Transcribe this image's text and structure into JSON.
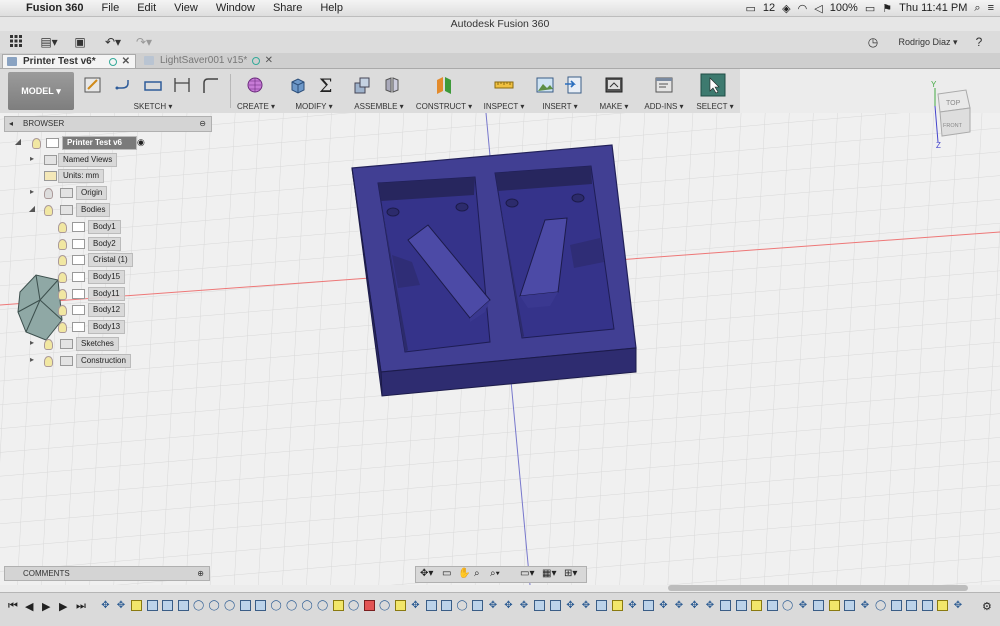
{
  "menubar": {
    "app_name": "Fusion 360",
    "items": [
      "File",
      "Edit",
      "View",
      "Window",
      "Share",
      "Help"
    ],
    "status": {
      "notifications": "12",
      "battery": "100%",
      "clock": "Thu 11:41 PM"
    }
  },
  "window_title": "Autodesk Fusion 360",
  "user": {
    "name": "Rodrigo Diaz"
  },
  "tabs": [
    {
      "label": "Printer Test v6*",
      "active": true
    },
    {
      "label": "LightSaver001 v15*",
      "active": false
    }
  ],
  "ribbon": {
    "workspace": "MODEL",
    "groups": [
      {
        "label": "SKETCH",
        "icon": "sketch-icon"
      },
      {
        "label": "CREATE",
        "icon": "create-icon"
      },
      {
        "label": "MODIFY",
        "icon": "modify-icon"
      },
      {
        "label": "ASSEMBLE",
        "icon": "assemble-icon"
      },
      {
        "label": "CONSTRUCT",
        "icon": "construct-icon"
      },
      {
        "label": "INSPECT",
        "icon": "inspect-icon"
      },
      {
        "label": "INSERT",
        "icon": "insert-icon"
      },
      {
        "label": "MAKE",
        "icon": "make-icon"
      },
      {
        "label": "ADD-INS",
        "icon": "addins-icon"
      },
      {
        "label": "SELECT",
        "icon": "select-icon"
      }
    ]
  },
  "browser": {
    "title": "BROWSER",
    "root": "Printer Test v6",
    "named_views": "Named Views",
    "units": "Units: mm",
    "origin": "Origin",
    "bodies": "Bodies",
    "body_items": [
      "Body1",
      "Body2",
      "Cristal (1)",
      "Body15",
      "Body11",
      "Body12",
      "Body13"
    ],
    "sketches": "Sketches",
    "construction": "Construction"
  },
  "comments": {
    "title": "COMMENTS"
  },
  "viewcube": {
    "top": "TOP",
    "front": "FRONT",
    "axis_y": "Y",
    "axis_z": "Z"
  },
  "colors": {
    "model_body": "#3f3d8f",
    "model_edge": "#22215a",
    "canvas": "#f0f0f0"
  }
}
